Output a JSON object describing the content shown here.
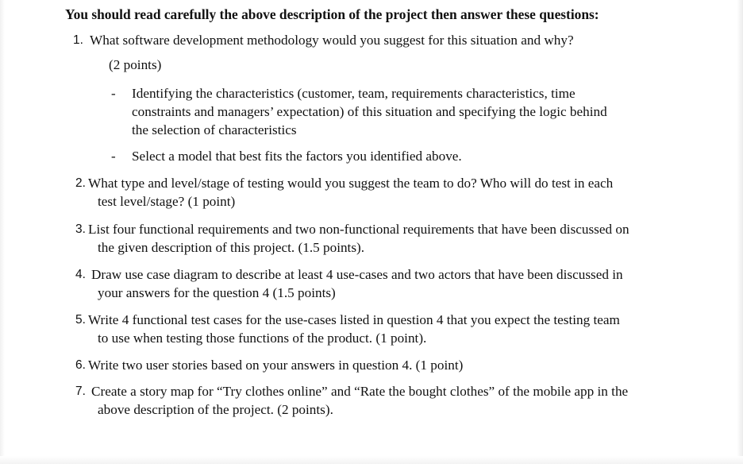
{
  "heading": "You should read carefully the above description of the project then answer these questions:",
  "questions": [
    {
      "number": "1.",
      "lines": [
        "What software development methodology would you suggest for this situation and why?"
      ],
      "points": "(2 points)",
      "bullets": [
        {
          "marker": "-",
          "lines": [
            "Identifying the characteristics (customer, team,  requirements characteristics, time",
            "constraints and managers’ expectation)  of this situation and specifying the logic behind",
            "the selection of characteristics"
          ]
        },
        {
          "marker": "-",
          "lines": [
            "Select a model that best fits the factors you identified above."
          ]
        }
      ]
    },
    {
      "number": "2.",
      "lines": [
        "What type and level/stage of testing would you suggest the team to do? Who will do test in each",
        "test level/stage? (1 point)"
      ]
    },
    {
      "number": "3.",
      "lines": [
        "List four functional requirements and two non-functional requirements that have been discussed on",
        "the given description of this project. (1.5 points)."
      ]
    },
    {
      "number": "4.",
      "lines": [
        "Draw use case diagram to describe at least 4 use-cases and two actors that have been discussed in",
        "your answers for the question 4 (1.5 points)"
      ]
    },
    {
      "number": "5.",
      "lines": [
        "Write 4 functional test cases for the use-cases listed in question 4 that you expect the testing team",
        "to use when testing those functions of the product. (1 point)."
      ]
    },
    {
      "number": "6.",
      "lines": [
        "Write two user stories based on your answers in question 4. (1 point)"
      ]
    },
    {
      "number": "7.",
      "lines": [
        "Create a story map for “Try clothes online” and “Rate the bought clothes” of the mobile app in the",
        "above description of the project. (2 points)."
      ]
    }
  ]
}
